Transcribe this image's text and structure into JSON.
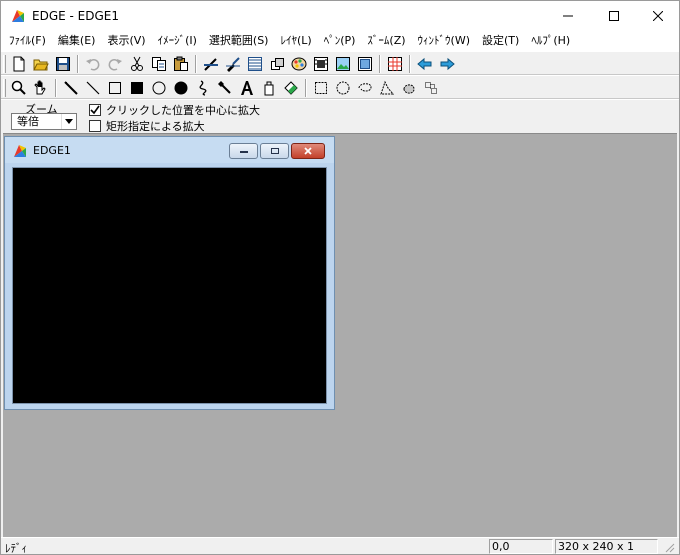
{
  "app": {
    "title": "EDGE - EDGE1"
  },
  "menu": [
    {
      "id": "file",
      "label": "ﾌｧｲﾙ(F)"
    },
    {
      "id": "edit",
      "label": "編集(E)"
    },
    {
      "id": "view",
      "label": "表示(V)"
    },
    {
      "id": "image",
      "label": "ｲﾒｰｼﾞ(I)"
    },
    {
      "id": "select",
      "label": "選択範囲(S)"
    },
    {
      "id": "layer",
      "label": "ﾚｲﾔ(L)"
    },
    {
      "id": "pen",
      "label": "ﾍﾟﾝ(P)"
    },
    {
      "id": "zoom",
      "label": "ｽﾞｰﾑ(Z)"
    },
    {
      "id": "window",
      "label": "ｳｨﾝﾄﾞｳ(W)"
    },
    {
      "id": "settings",
      "label": "設定(T)"
    },
    {
      "id": "help",
      "label": "ﾍﾙﾌﾟ(H)"
    }
  ],
  "toolbar1": [
    "new-file-icon",
    "open-folder-icon",
    "save-icon",
    "undo-icon",
    "redo-icon",
    "cut-icon",
    "copy-icon",
    "paste-icon",
    "pen-settings-icon",
    "brush-settings-icon",
    "pattern-icon",
    "transform-icon",
    "palette-icon",
    "film-icon",
    "image-view-icon",
    "image-view2-icon",
    "grid-icon",
    "prev-frame-icon",
    "next-frame-icon"
  ],
  "toolbar2": [
    "zoom-tool-icon",
    "hand-tool-icon",
    "pen-tool-icon",
    "line-tool-icon",
    "rect-tool-icon",
    "filled-rect-tool-icon",
    "ellipse-tool-icon",
    "filled-ellipse-tool-icon",
    "curve-tool-icon",
    "eyedropper-tool-icon",
    "text-tool-icon",
    "bucket-tool-icon",
    "fill-tool-icon",
    "rect-select-icon",
    "ellipse-select-icon",
    "lasso-select-icon",
    "polygon-select-icon",
    "magic-select-icon",
    "pixel-select-icon"
  ],
  "zoom_options": {
    "label": "ズーム",
    "selected": "等倍",
    "checkbox_center": {
      "label": "クリックした位置を中心に拡大",
      "checked": true
    },
    "checkbox_rect": {
      "label": "矩形指定による拡大",
      "checked": false
    }
  },
  "child_window": {
    "title": "EDGE1",
    "canvas_color": "#000000"
  },
  "status": {
    "message": "ﾚﾃﾞｨ",
    "coords": "0,0",
    "size": "320 x 240 x 1"
  }
}
